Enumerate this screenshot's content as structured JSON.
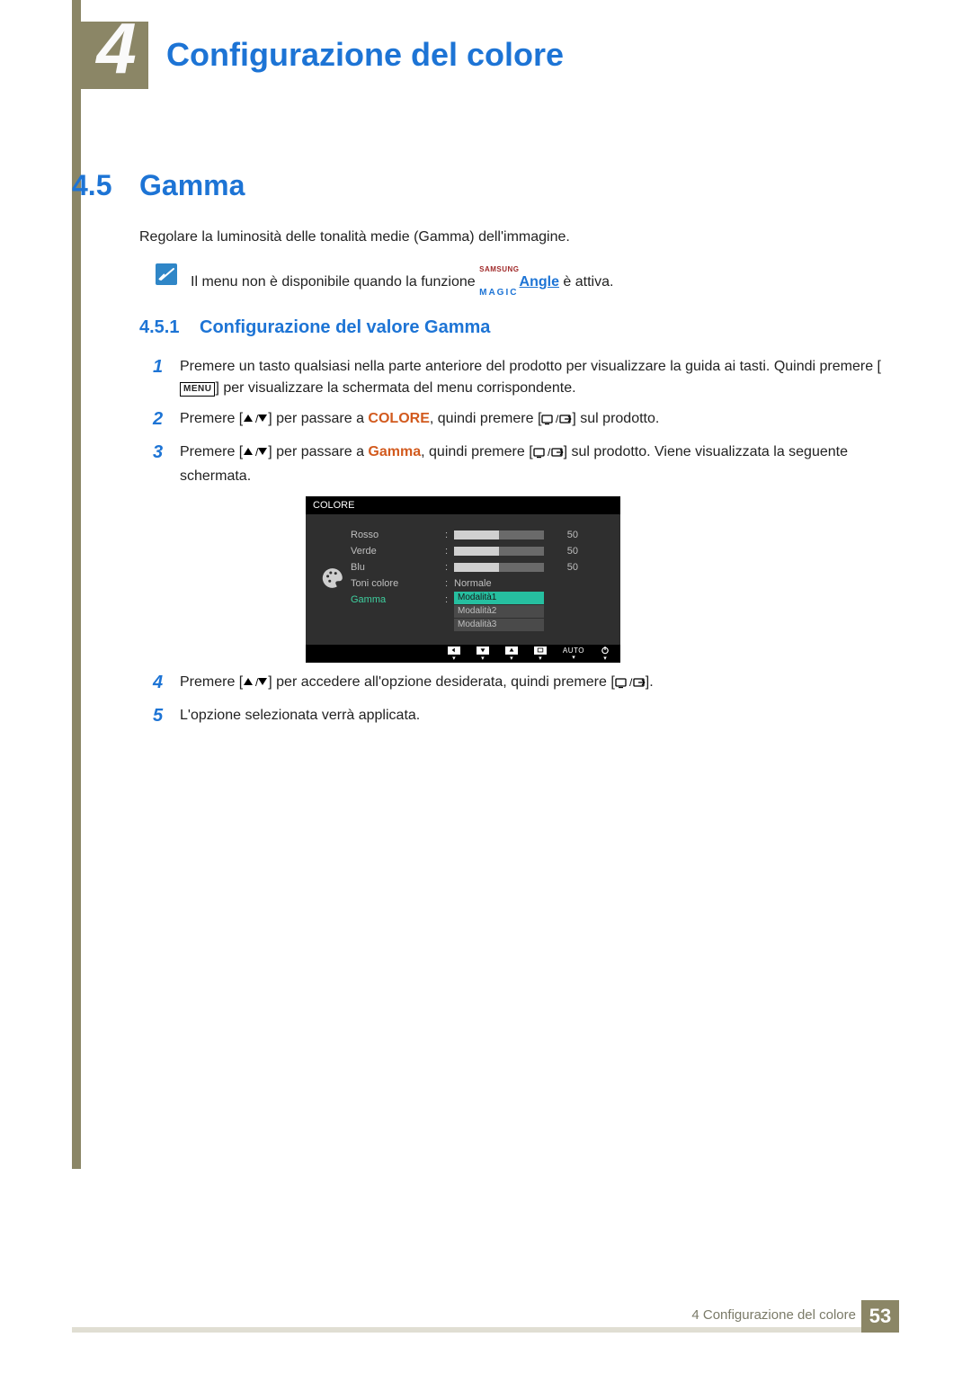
{
  "chapter": {
    "number": "4",
    "title": "Configurazione del colore"
  },
  "section": {
    "number": "4.5",
    "title": "Gamma"
  },
  "intro": "Regolare la luminosità delle tonalità medie (Gamma) dell'immagine.",
  "note": {
    "prefix": "Il menu non è disponibile quando la funzione ",
    "brand_top": "SAMSUNG",
    "brand_bottom": "MAGIC",
    "angle": "Angle",
    "suffix": " è attiva."
  },
  "subsection": {
    "number": "4.5.1",
    "title": "Configurazione del valore Gamma"
  },
  "steps": {
    "s1": {
      "num": "1",
      "a": "Premere un tasto qualsiasi nella parte anteriore del prodotto per visualizzare la guida ai tasti. Quindi premere [",
      "menu": "MENU",
      "b": "] per visualizzare la schermata del menu corrispondente."
    },
    "s2": {
      "num": "2",
      "a": "Premere [",
      "b": "] per passare a ",
      "colore": "COLORE",
      "c": ", quindi premere [",
      "d": "] sul prodotto."
    },
    "s3": {
      "num": "3",
      "a": "Premere [",
      "b": "] per passare a ",
      "gamma": "Gamma",
      "c": ", quindi premere [",
      "d": "] sul prodotto. Viene visualizzata la seguente schermata."
    },
    "s4": {
      "num": "4",
      "a": "Premere [",
      "b": "] per accedere all'opzione desiderata, quindi premere [",
      "c": "]."
    },
    "s5": {
      "num": "5",
      "a": "L'opzione selezionata verrà applicata."
    }
  },
  "osd": {
    "title": "COLORE",
    "rows": {
      "rosso": {
        "label": "Rosso",
        "value": "50",
        "fill": 50
      },
      "verde": {
        "label": "Verde",
        "value": "50",
        "fill": 50
      },
      "blu": {
        "label": "Blu",
        "value": "50",
        "fill": 50
      },
      "toni": {
        "label": "Toni colore",
        "value": "Normale"
      },
      "gamma": {
        "label": "Gamma"
      }
    },
    "options": [
      "Modalità1",
      "Modalità2",
      "Modalità3"
    ],
    "nav": {
      "auto": "AUTO"
    }
  },
  "footer": {
    "text": "4  Configurazione del colore",
    "page": "53"
  }
}
